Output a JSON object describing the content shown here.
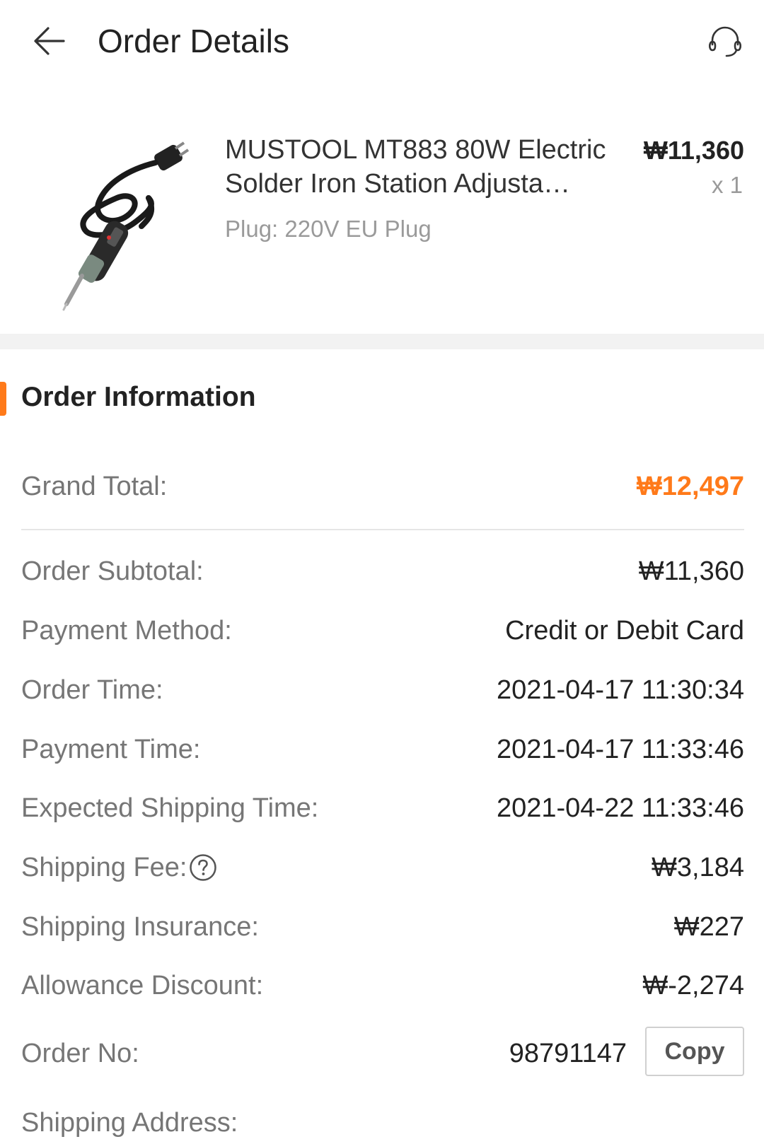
{
  "header": {
    "title": "Order Details",
    "back_icon": "arrow-left-icon",
    "support_icon": "headset-icon"
  },
  "product": {
    "name": "MUSTOOL MT883 80W Electric Solder Iron Station Adjusta…",
    "option": "Plug: 220V EU Plug",
    "price": "₩11,360",
    "quantity": "x 1"
  },
  "order_info": {
    "title": "Order Information",
    "accent_color": "#ff7a1a",
    "grand_total": {
      "label": "Grand Total:",
      "value": "₩12,497"
    },
    "rows": [
      {
        "label": "Order Subtotal:",
        "value": "₩11,360"
      },
      {
        "label": "Payment Method:",
        "value": "Credit or Debit Card"
      },
      {
        "label": "Order Time:",
        "value": "2021-04-17 11:30:34"
      },
      {
        "label": "Payment Time:",
        "value": "2021-04-17 11:33:46"
      },
      {
        "label": "Expected Shipping Time:",
        "value": "2021-04-22 11:33:46"
      },
      {
        "label": "Shipping Fee:",
        "value": "₩3,184"
      },
      {
        "label": "Shipping Insurance:",
        "value": "₩227"
      },
      {
        "label": "Allowance Discount:",
        "value": "₩-2,274"
      }
    ],
    "order_no": {
      "label": "Order No:",
      "value": "98791147",
      "copy_label": "Copy"
    },
    "shipping_address": {
      "label": "Shipping Address:"
    }
  }
}
